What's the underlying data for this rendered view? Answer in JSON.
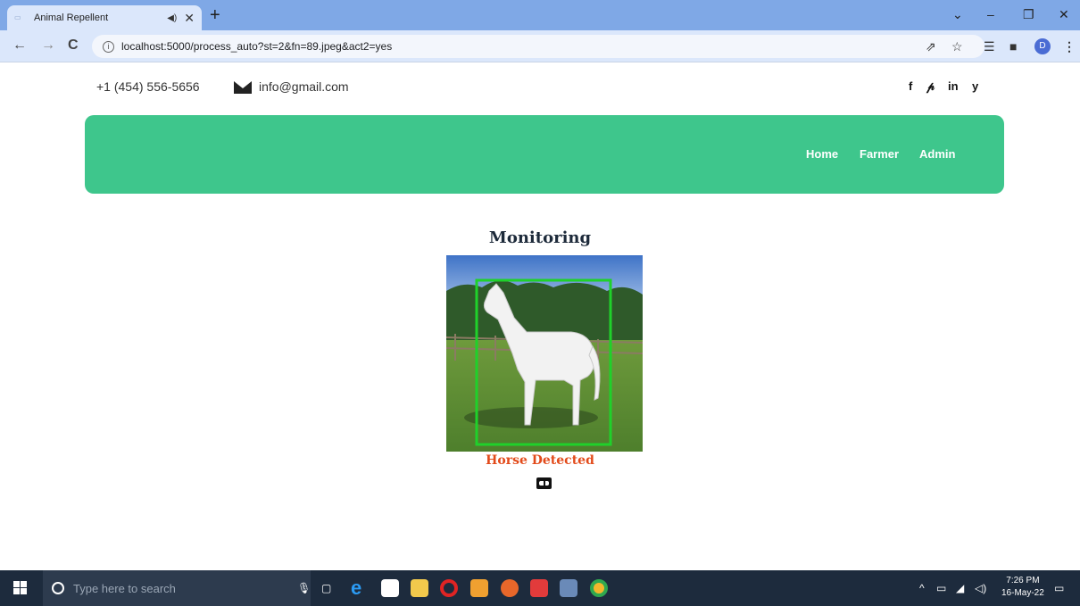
{
  "browser": {
    "tab_title": "Animal Repellent",
    "url": "localhost:5000/process_auto?st=2&fn=89.jpeg&act2=yes",
    "profile_initial": "D"
  },
  "header": {
    "phone": "+1 (454) 556-5656",
    "email": "info@gmail.com",
    "social": [
      "f",
      "𝓅",
      "in",
      "y"
    ]
  },
  "nav": {
    "links": [
      "Home",
      "Farmer",
      "Admin"
    ]
  },
  "main": {
    "title": "Monitoring",
    "detection_label": "Horse Detected",
    "image_alt": "horse"
  },
  "taskbar": {
    "search_placeholder": "Type here to search",
    "time": "7:26 PM",
    "date": "16-May-22"
  },
  "colors": {
    "nav_bg": "#3ec68c",
    "detection_text": "#e24a1a",
    "bbox": "#1fd12a"
  }
}
